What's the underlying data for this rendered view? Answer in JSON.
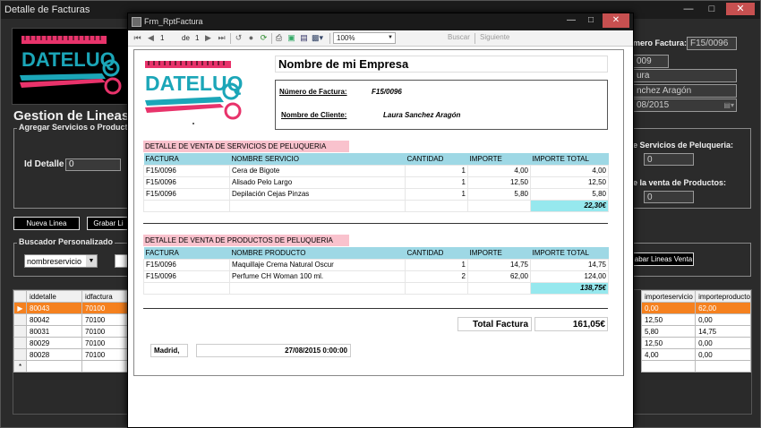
{
  "main": {
    "title": "Detalle de Facturas",
    "heading": "Gestion de Lineas d",
    "group_servicios_title": "Agregar Servicios o Productos",
    "id_detalle_label": "Id Detalle",
    "id_detalle_value": "0",
    "btn_nueva_linea": "Nueva Linea",
    "btn_grabar": "Grabar Li",
    "buscador_title": "Buscador Personalizado",
    "buscador_combo": "nombreservicio",
    "right": {
      "numero_factura_label": "mero Factura:",
      "numero_factura_value": "F15/0096",
      "field2": "009",
      "field3": "ura",
      "field4": "nchez Aragón",
      "field5": "08/2015",
      "servicios_label": "e Servicios de Peluqueria:",
      "servicios_value": "0",
      "productos_label": "e la venta de Productos:",
      "productos_value": "0",
      "btn_grabar_lineas": "abar Lineas Venta"
    },
    "grid": {
      "headers": [
        "iddetalle",
        "idfactura"
      ],
      "rows": [
        [
          "80043",
          "70100"
        ],
        [
          "80042",
          "70100"
        ],
        [
          "80031",
          "70100"
        ],
        [
          "80029",
          "70100"
        ],
        [
          "80028",
          "70100"
        ]
      ],
      "right_headers": [
        "importeservicio",
        "importeproducto"
      ],
      "right_rows": [
        [
          "0,00",
          "62,00"
        ],
        [
          "12,50",
          "0,00"
        ],
        [
          "5,80",
          "14,75"
        ],
        [
          "12,50",
          "0,00"
        ],
        [
          "4,00",
          "0,00"
        ]
      ],
      "row_marker": "▶",
      "new_row_marker": "*"
    }
  },
  "dialog": {
    "title": "Frm_RptFactura",
    "toolbar": {
      "page": "1",
      "of_label": "de",
      "total_pages": "1",
      "zoom": "100%",
      "search": "Buscar",
      "next": "Siguiente"
    },
    "report": {
      "company": "Nombre de mi Empresa",
      "logo_text": "DATELUQ",
      "numero_factura_label": "Número de Factura:",
      "numero_factura_value": "F15/0096",
      "cliente_label": "Nombre de Cliente:",
      "cliente_value": "Laura Sanchez Aragón",
      "servicios": {
        "title": "DETALLE DE VENTA DE SERVICIOS DE PELUQUERIA",
        "headers": [
          "FACTURA",
          "NOMBRE SERVICIO",
          "CANTIDAD",
          "IMPORTE",
          "IMPORTE TOTAL"
        ],
        "rows": [
          [
            "F15/0096",
            "Cera de Bigote",
            "1",
            "4,00",
            "4,00"
          ],
          [
            "F15/0096",
            "Alisado Pelo Largo",
            "1",
            "12,50",
            "12,50"
          ],
          [
            "F15/0096",
            "Depilación Cejas Pinzas",
            "1",
            "5,80",
            "5,80"
          ]
        ],
        "total": "22,30€"
      },
      "productos": {
        "title": "DETALLE DE VENTA DE PRODUCTOS DE PELUQUERIA",
        "headers": [
          "FACTURA",
          "NOMBRE PRODUCTO",
          "CANTIDAD",
          "IMPORTE",
          "IMPORTE TOTAL"
        ],
        "rows": [
          [
            "F15/0096",
            "Maquillaje Crema Natural Oscur",
            "1",
            "14,75",
            "14,75"
          ],
          [
            "F15/0096",
            "Perfume CH Woman 100 ml.",
            "2",
            "62,00",
            "124,00"
          ]
        ],
        "total": "138,75€"
      },
      "total_factura_label": "Total Factura",
      "total_factura_value": "161,05€",
      "city": "Madrid,",
      "date": "27/08/2015 0:00:00"
    }
  },
  "colors": {
    "accent_pink": "#e8336b",
    "accent_teal": "#1ba6b8",
    "selected_row": "#f5811f",
    "section_pink": "#f9c2cd",
    "header_blue": "#9ed8e5"
  }
}
